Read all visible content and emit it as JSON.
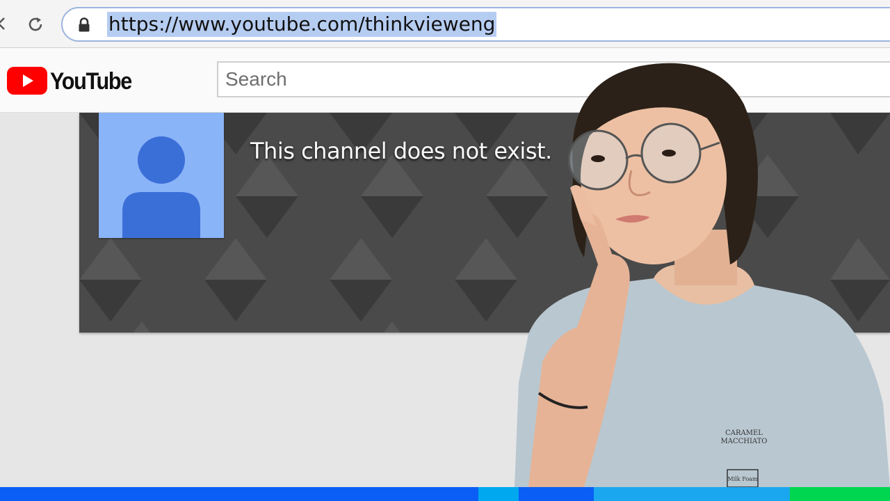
{
  "browser": {
    "url": "https://www.youtube.com/thinkvieweng"
  },
  "youtube": {
    "logo_text": "YouTube",
    "search_placeholder": "Search"
  },
  "channel": {
    "message": "This channel does not exist."
  },
  "person": {
    "shirt_print": [
      "CARAMEL",
      "MACCHIATO"
    ],
    "cup_label": "Milk Foam"
  },
  "colors": {
    "youtube_red": "#ff0000",
    "avatar_bg": "#8ab4f8",
    "avatar_figure": "#3b6fd8",
    "banner_bg": "#4a4a4a",
    "stripe": [
      "#0a5ef5",
      "#00a8f0",
      "#0a5ef5",
      "#1aa7ef",
      "#00d64f"
    ]
  }
}
